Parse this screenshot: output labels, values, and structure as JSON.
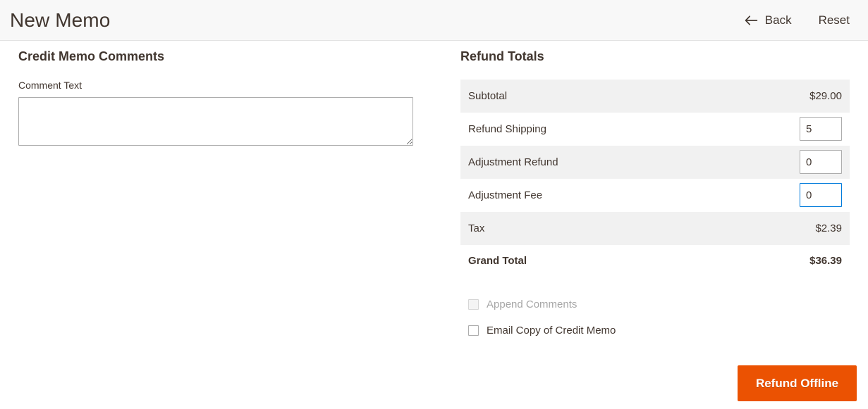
{
  "header": {
    "title": "New Memo",
    "back_label": "Back",
    "back_icon": "arrow-left-icon",
    "reset_label": "Reset"
  },
  "comments_section": {
    "title": "Credit Memo Comments",
    "comment_label": "Comment Text",
    "comment_value": "",
    "comment_placeholder": ""
  },
  "refund_totals": {
    "title": "Refund Totals",
    "rows": [
      {
        "label": "Subtotal",
        "type": "text",
        "value": "$29.00",
        "striped": true,
        "focused": false
      },
      {
        "label": "Refund Shipping",
        "type": "input",
        "value": "5",
        "striped": false,
        "focused": false
      },
      {
        "label": "Adjustment Refund",
        "type": "input",
        "value": "0",
        "striped": true,
        "focused": false
      },
      {
        "label": "Adjustment Fee",
        "type": "input",
        "value": "0",
        "striped": false,
        "focused": true
      },
      {
        "label": "Tax",
        "type": "text",
        "value": "$2.39",
        "striped": true,
        "focused": false
      },
      {
        "label": "Grand Total",
        "type": "text",
        "value": "$36.39",
        "striped": false,
        "focused": false,
        "bold": true
      }
    ],
    "checkboxes": [
      {
        "label": "Append Comments",
        "checked": false,
        "disabled": true
      },
      {
        "label": "Email Copy of Credit Memo",
        "checked": false,
        "disabled": false
      }
    ],
    "submit_label": "Refund Offline"
  },
  "colors": {
    "accent_orange": "#eb5202",
    "focus_blue": "#007bdb",
    "row_stripe": "#f1f1f1",
    "header_bg": "#f8f8f8",
    "text": "#41362f",
    "muted_text": "#a6a6a6"
  }
}
